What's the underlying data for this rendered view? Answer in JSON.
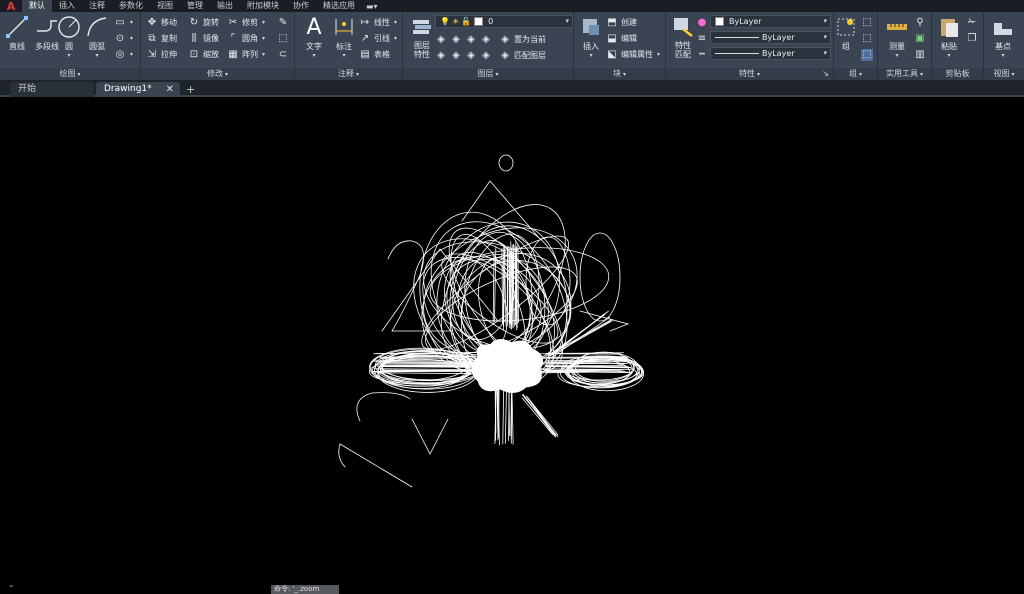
{
  "app": {
    "logo": "A"
  },
  "menu": {
    "tabs": [
      "默认",
      "插入",
      "注释",
      "参数化",
      "视图",
      "管理",
      "输出",
      "附加模块",
      "协作",
      "精选应用"
    ],
    "active_index": 0
  },
  "ribbon": {
    "draw": {
      "title": "绘图",
      "line": "直线",
      "polyline": "多段线",
      "circle": "圆",
      "arc": "圆弧"
    },
    "modify": {
      "title": "修改",
      "move": "移动",
      "rotate": "旋转",
      "trim": "修剪",
      "copy": "复制",
      "mirror": "镜像",
      "fillet": "圆角",
      "stretch": "拉伸",
      "scale": "缩放",
      "array": "阵列"
    },
    "annotation": {
      "title": "注释",
      "text": "文字",
      "dimension": "标注",
      "linear": "线性",
      "leader": "引线",
      "table": "表格"
    },
    "layers": {
      "title": "图层",
      "layer_props": "图层\n特性",
      "current_layer": "0",
      "make_current": "置为当前",
      "match_layer": "匹配图层"
    },
    "block": {
      "title": "块",
      "insert": "插入",
      "create": "创建",
      "edit": "编辑",
      "edit_attr": "编辑属性"
    },
    "properties": {
      "title": "特性",
      "match": "特性\n匹配",
      "color": "ByLayer",
      "linetype": "ByLayer",
      "lineweight": "ByLayer"
    },
    "groups": {
      "title": "组",
      "group": "组"
    },
    "utilities": {
      "title": "实用工具",
      "measure": "测量"
    },
    "clipboard": {
      "title": "剪贴板",
      "paste": "粘贴"
    },
    "view": {
      "title": "视图",
      "base": "基点"
    }
  },
  "doc_tabs": {
    "start": "开始",
    "drawing": "Drawing1*"
  },
  "command": {
    "text": "命令: '_.zoom"
  },
  "colors": {
    "ribbon_bg": "#3b4453",
    "canvas_bg": "#000000",
    "drawing_stroke": "#ffffff",
    "logo_red": "#e0383a"
  },
  "icons": [
    "line-icon",
    "polyline-icon",
    "circle-icon",
    "arc-icon",
    "move-icon",
    "rotate-icon",
    "trim-icon",
    "copy-icon",
    "mirror-icon",
    "fillet-icon",
    "stretch-icon",
    "scale-icon",
    "array-icon",
    "text-icon",
    "dimension-icon",
    "layer-properties-icon",
    "insert-icon",
    "match-properties-icon",
    "group-icon",
    "measure-icon",
    "paste-icon",
    "base-view-icon"
  ]
}
